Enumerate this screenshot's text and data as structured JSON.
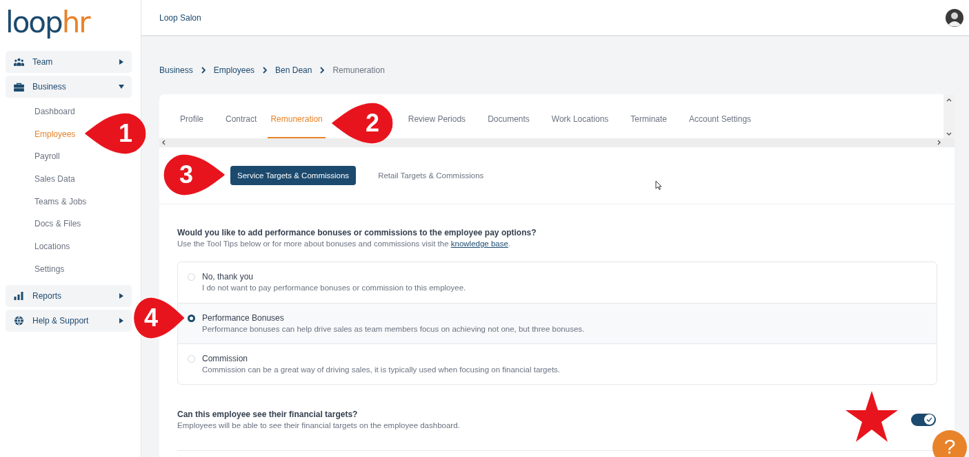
{
  "logo": {
    "part1": "loop",
    "part2": "hr"
  },
  "header": {
    "company": "Loop Salon"
  },
  "sidebar": {
    "items": [
      {
        "label": "Team",
        "expanded": false
      },
      {
        "label": "Business",
        "expanded": true,
        "children": [
          {
            "label": "Dashboard",
            "selected": false
          },
          {
            "label": "Employees",
            "selected": true
          },
          {
            "label": "Payroll",
            "selected": false
          },
          {
            "label": "Sales Data",
            "selected": false
          },
          {
            "label": "Teams & Jobs",
            "selected": false
          },
          {
            "label": "Docs & Files",
            "selected": false
          },
          {
            "label": "Locations",
            "selected": false
          },
          {
            "label": "Settings",
            "selected": false
          }
        ]
      },
      {
        "label": "Reports",
        "expanded": false
      },
      {
        "label": "Help & Support",
        "expanded": false
      }
    ]
  },
  "breadcrumb": [
    "Business",
    "Employees",
    "Ben Dean",
    "Remuneration"
  ],
  "tabs": [
    {
      "label": "Profile",
      "selected": false
    },
    {
      "label": "Contract",
      "selected": false
    },
    {
      "label": "Remuneration",
      "selected": true
    },
    {
      "label": "Review Periods",
      "selected": false
    },
    {
      "label": "Documents",
      "selected": false
    },
    {
      "label": "Work Locations",
      "selected": false
    },
    {
      "label": "Terminate",
      "selected": false
    },
    {
      "label": "Account Settings",
      "selected": false
    }
  ],
  "subtabs": [
    {
      "label": "Service Targets & Commissions",
      "selected": true
    },
    {
      "label": "Retail Targets & Commissions",
      "selected": false
    }
  ],
  "question": {
    "title": "Would you like to add performance bonuses or commissions to the employee pay options?",
    "hint": "Use the Tool Tips below or for more about bonuses and commissions visit the",
    "link": "knowledge base",
    "end": "."
  },
  "options": [
    {
      "label": "No, thank you",
      "description": "I do not want to pay performance bonuses or commission to this employee.",
      "selected": false
    },
    {
      "label": "Performance Bonuses",
      "description": "Performance bonuses can help drive sales as team members focus on achieving not one, but three bonuses.",
      "selected": true
    },
    {
      "label": "Commission",
      "description": "Commission can be a great way of driving sales, it is typically used when focusing on financial targets.",
      "selected": false
    }
  ],
  "visibility": {
    "title": "Can this employee see their financial targets?",
    "description": "Employees will be able to see their financial targets on the employee dashboard.",
    "on": true
  },
  "help_button": {
    "label": "?"
  },
  "callouts": [
    {
      "number": "1"
    },
    {
      "number": "2"
    },
    {
      "number": "3"
    },
    {
      "number": "4"
    }
  ],
  "star_marker": {
    "kind": "star"
  }
}
